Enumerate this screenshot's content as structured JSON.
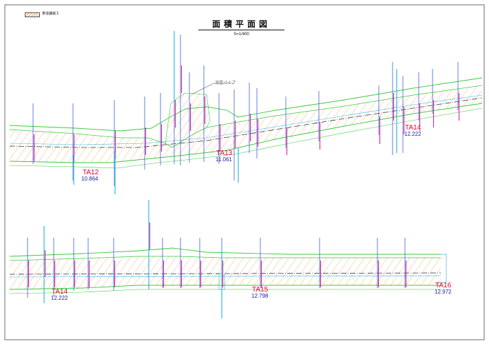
{
  "legend": {
    "label": "車道舗装工"
  },
  "header": {
    "title": "面積平面図",
    "scale": "S=1/400"
  },
  "callout": {
    "label": "消雪パイプ"
  },
  "colors": {
    "outline_green": "#38c83a",
    "hatch_orange": "#f4a460",
    "section_blue": "#3a5fd8",
    "section_cyan": "#31b7e0",
    "width_magenta": "#d6209d",
    "station_red": "#e4002b",
    "station_value_blue": "#1a1aa6",
    "centerline": "#3a3a3a"
  },
  "stations": [
    {
      "name": "TA12",
      "value": "10.864"
    },
    {
      "name": "TA13",
      "value": "11.061"
    },
    {
      "name": "TA14",
      "value": "12.222"
    },
    {
      "name": "TA14",
      "value": "12.222"
    },
    {
      "name": "TA15",
      "value": "12.798"
    },
    {
      "name": "TA16",
      "value": "12.972"
    }
  ]
}
